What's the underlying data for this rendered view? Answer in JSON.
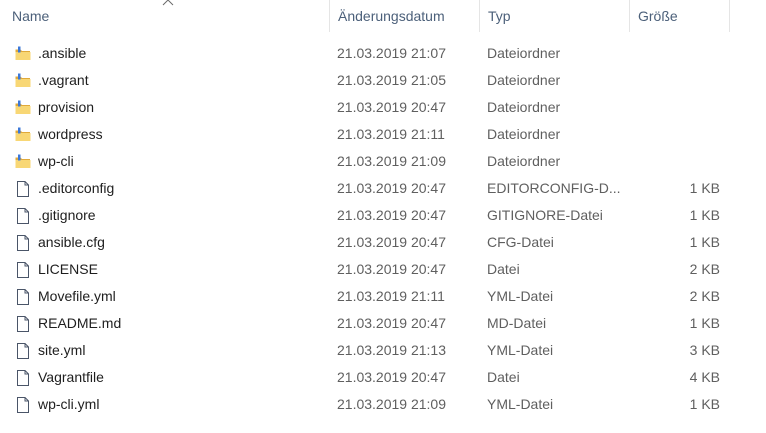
{
  "columns": {
    "name": "Name",
    "date": "Änderungsdatum",
    "type": "Typ",
    "size": "Größe"
  },
  "files": [
    {
      "name": ".ansible",
      "date": "21.03.2019 21:07",
      "type": "Dateiordner",
      "size": "",
      "icon": "folder-icon"
    },
    {
      "name": ".vagrant",
      "date": "21.03.2019 21:05",
      "type": "Dateiordner",
      "size": "",
      "icon": "folder-icon"
    },
    {
      "name": "provision",
      "date": "21.03.2019 20:47",
      "type": "Dateiordner",
      "size": "",
      "icon": "folder-icon"
    },
    {
      "name": "wordpress",
      "date": "21.03.2019 21:11",
      "type": "Dateiordner",
      "size": "",
      "icon": "folder-icon"
    },
    {
      "name": "wp-cli",
      "date": "21.03.2019 21:09",
      "type": "Dateiordner",
      "size": "",
      "icon": "folder-icon"
    },
    {
      "name": ".editorconfig",
      "date": "21.03.2019 20:47",
      "type": "EDITORCONFIG-D...",
      "size": "1 KB",
      "icon": "file-icon"
    },
    {
      "name": ".gitignore",
      "date": "21.03.2019 20:47",
      "type": "GITIGNORE-Datei",
      "size": "1 KB",
      "icon": "file-icon"
    },
    {
      "name": "ansible.cfg",
      "date": "21.03.2019 20:47",
      "type": "CFG-Datei",
      "size": "1 KB",
      "icon": "file-icon"
    },
    {
      "name": "LICENSE",
      "date": "21.03.2019 20:47",
      "type": "Datei",
      "size": "2 KB",
      "icon": "file-icon"
    },
    {
      "name": "Movefile.yml",
      "date": "21.03.2019 21:11",
      "type": "YML-Datei",
      "size": "2 KB",
      "icon": "file-icon"
    },
    {
      "name": "README.md",
      "date": "21.03.2019 20:47",
      "type": "MD-Datei",
      "size": "1 KB",
      "icon": "file-icon"
    },
    {
      "name": "site.yml",
      "date": "21.03.2019 21:13",
      "type": "YML-Datei",
      "size": "3 KB",
      "icon": "file-icon"
    },
    {
      "name": "Vagrantfile",
      "date": "21.03.2019 20:47",
      "type": "Datei",
      "size": "4 KB",
      "icon": "file-icon"
    },
    {
      "name": "wp-cli.yml",
      "date": "21.03.2019 21:09",
      "type": "YML-Datei",
      "size": "1 KB",
      "icon": "file-icon"
    }
  ],
  "colors": {
    "header_text": "#4c607a",
    "folder_yellow": "#f8d775",
    "folder_dark": "#e0a93a",
    "folder_blue_marker": "#3c78d8",
    "file_outline": "#4a5568"
  },
  "sort": {
    "column": "name",
    "direction": "ascending",
    "indicator": "caret-up-icon"
  }
}
